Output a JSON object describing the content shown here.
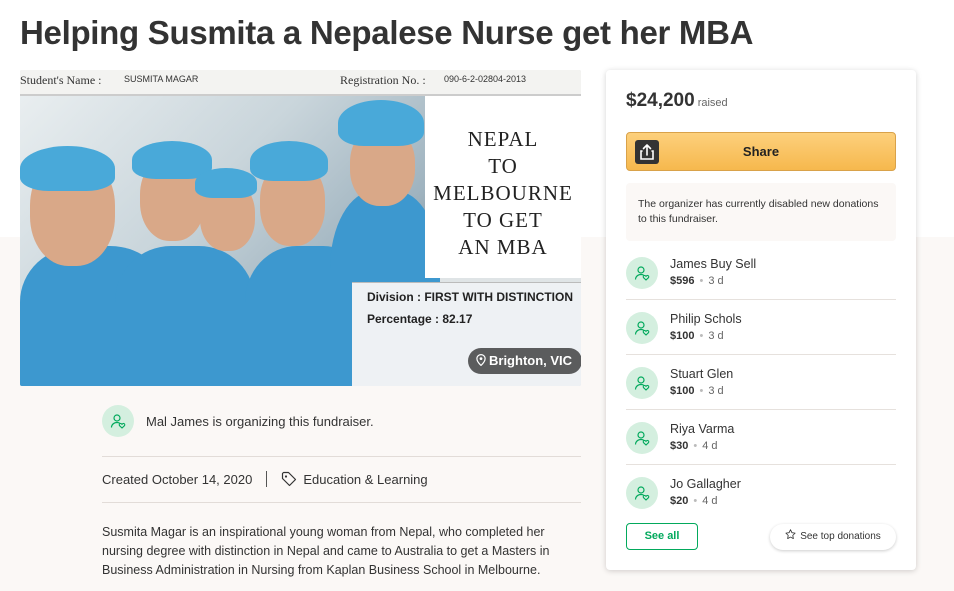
{
  "page": {
    "title": "Helping Susmita a Nepalese Nurse get her MBA"
  },
  "hero": {
    "cert_header": {
      "student_name_label": "Student's Name :",
      "student_name_value": "SUSMITA MAGAR",
      "registration_label": "Registration No. :",
      "registration_value": "090-6-2-02804-2013"
    },
    "poster_lines": [
      "NEPAL",
      "TO",
      "MELBOURNE",
      "TO GET",
      "AN MBA"
    ],
    "division_line": "Division : FIRST WITH DISTINCTION",
    "percentage_line": "Percentage :  82.17",
    "location": "Brighton, VIC"
  },
  "organizer": {
    "text": "Mal James is organizing this fundraiser."
  },
  "meta": {
    "created": "Created October 14, 2020",
    "category": "Education & Learning"
  },
  "description": "Susmita Magar is an inspirational young woman from Nepal, who completed her nursing degree with distinction in Nepal and came to Australia to get a Masters in Business Administration in Nursing from Kaplan Business School in Melbourne.",
  "sidebar": {
    "amount_raised": "$24,200",
    "raised_label": "raised",
    "share_label": "Share",
    "notice": "The organizer has currently disabled new donations to this fundraiser.",
    "donations": [
      {
        "name": "James Buy Sell",
        "amount": "$596",
        "time": "3 d"
      },
      {
        "name": "Philip Schols",
        "amount": "$100",
        "time": "3 d"
      },
      {
        "name": "Stuart Glen",
        "amount": "$100",
        "time": "3 d"
      },
      {
        "name": "Riya Varma",
        "amount": "$30",
        "time": "4 d"
      },
      {
        "name": "Jo Gallagher",
        "amount": "$20",
        "time": "4 d"
      }
    ],
    "see_all_label": "See all",
    "see_top_label": "See top donations"
  },
  "colors": {
    "brand_green": "#02a95c",
    "share_orange": "#f6b84d",
    "page_tint": "#fbf8f6"
  },
  "icons": {
    "avatar": "user-heart-icon",
    "share": "share-icon",
    "tag": "tag-icon",
    "location": "location-pin-icon",
    "star": "star-icon"
  }
}
